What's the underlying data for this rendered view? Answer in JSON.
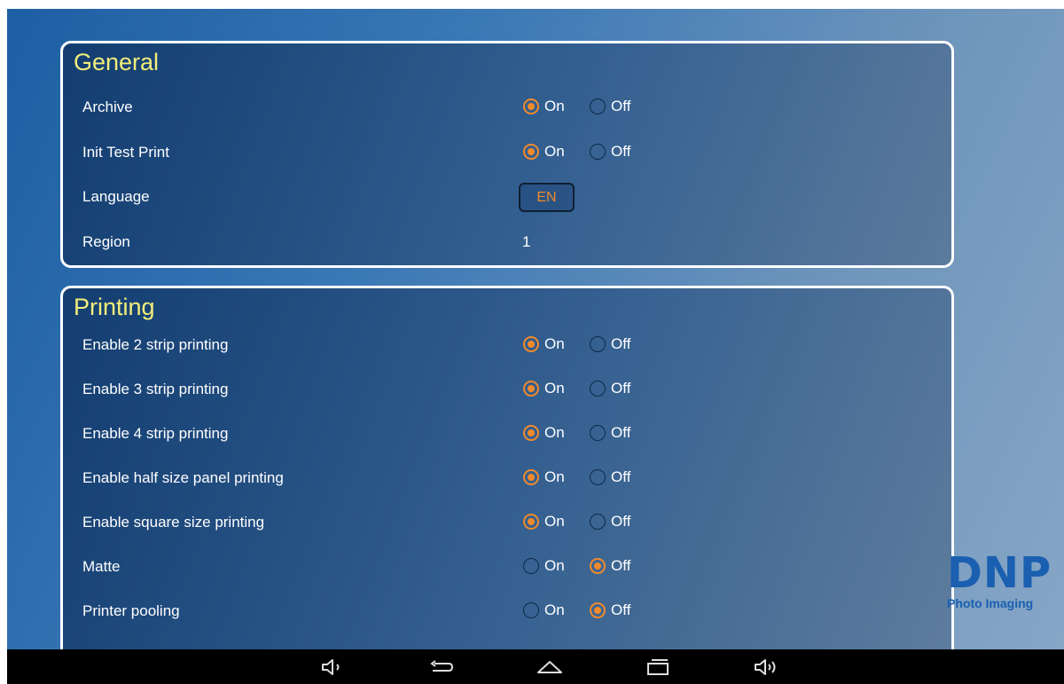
{
  "general": {
    "title": "General",
    "archive": {
      "label": "Archive",
      "on": "On",
      "off": "Off",
      "value": "On"
    },
    "init_test_print": {
      "label": "Init Test Print",
      "on": "On",
      "off": "Off",
      "value": "On"
    },
    "language": {
      "label": "Language",
      "button": "EN"
    },
    "region": {
      "label": "Region",
      "value": "1"
    }
  },
  "printing": {
    "title": "Printing",
    "rows": [
      {
        "label": "Enable 2 strip printing",
        "on": "On",
        "off": "Off",
        "value": "On"
      },
      {
        "label": "Enable 3 strip printing",
        "on": "On",
        "off": "Off",
        "value": "On"
      },
      {
        "label": "Enable 4 strip printing",
        "on": "On",
        "off": "Off",
        "value": "On"
      },
      {
        "label": "Enable half size panel printing",
        "on": "On",
        "off": "Off",
        "value": "On"
      },
      {
        "label": "Enable square size printing",
        "on": "On",
        "off": "Off",
        "value": "On"
      },
      {
        "label": "Matte",
        "on": "On",
        "off": "Off",
        "value": "Off"
      },
      {
        "label": "Printer pooling",
        "on": "On",
        "off": "Off",
        "value": "Off"
      }
    ]
  },
  "logo": {
    "brand": "DNP",
    "subtitle": "Photo Imaging"
  },
  "navbar": {
    "icons": [
      "volume-down-icon",
      "back-icon",
      "home-icon",
      "recents-icon",
      "volume-up-icon"
    ]
  },
  "colors": {
    "accent": "#f08a2c",
    "title": "#f2ee7a",
    "brand": "#1a5fb0"
  }
}
